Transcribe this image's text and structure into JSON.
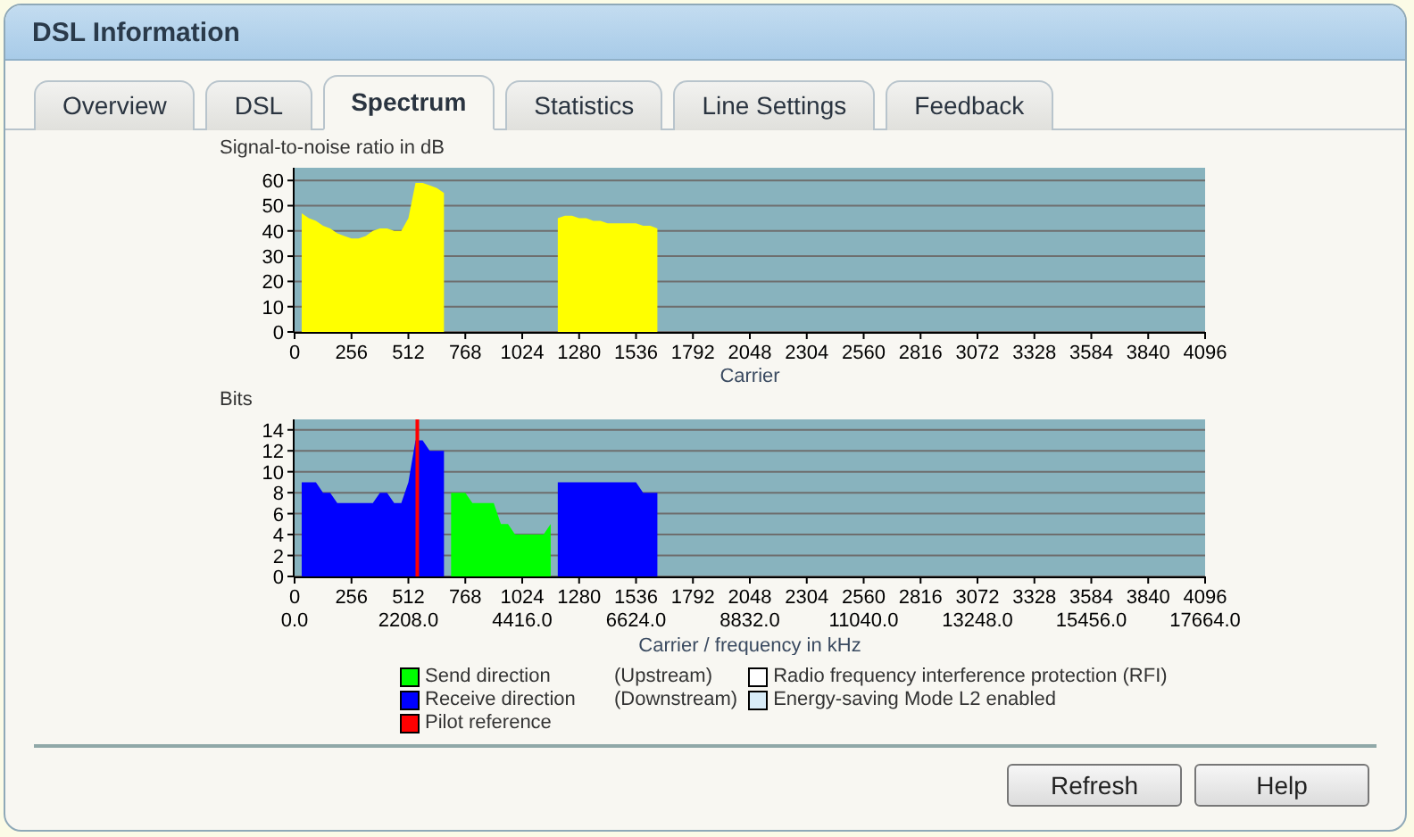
{
  "window": {
    "title": "DSL Information"
  },
  "tabs": [
    {
      "label": "Overview",
      "selected": false
    },
    {
      "label": "DSL",
      "selected": false
    },
    {
      "label": "Spectrum",
      "selected": true
    },
    {
      "label": "Statistics",
      "selected": false
    },
    {
      "label": "Line Settings",
      "selected": false
    },
    {
      "label": "Feedback",
      "selected": false
    }
  ],
  "snr_chart": {
    "chart_data": {
      "type": "area",
      "title": "Signal-to-noise ratio in dB",
      "xlabel": "Carrier",
      "grid": true,
      "x": [
        32,
        64,
        96,
        128,
        160,
        192,
        224,
        256,
        288,
        320,
        352,
        384,
        416,
        448,
        480,
        512,
        544,
        576,
        608,
        640,
        672,
        704,
        736,
        768,
        800,
        832,
        864,
        896,
        928,
        960,
        992,
        1024,
        1056,
        1088,
        1120,
        1152,
        1184,
        1216,
        1248,
        1280,
        1312,
        1344,
        1376,
        1408,
        1440,
        1472,
        1504,
        1536,
        1568,
        1600,
        1632
      ],
      "series": [
        {
          "color": "#ffff00",
          "values": [
            47,
            45,
            44,
            42,
            41,
            39,
            38,
            37,
            37,
            38,
            40,
            41,
            41,
            40,
            40,
            45,
            59,
            59,
            58,
            57,
            55,
            null,
            null,
            null,
            null,
            null,
            null,
            null,
            null,
            null,
            null,
            null,
            null,
            null,
            null,
            null,
            45,
            46,
            46,
            45,
            45,
            44,
            44,
            43,
            43,
            43,
            43,
            43,
            42,
            42,
            41
          ]
        }
      ],
      "xlim": [
        0,
        4096
      ],
      "ylim": [
        0,
        65
      ],
      "xticks": [
        0,
        256,
        512,
        768,
        1024,
        1280,
        1536,
        1792,
        2048,
        2304,
        2560,
        2816,
        3072,
        3328,
        3584,
        3840,
        4096
      ],
      "yticks": [
        0,
        10,
        20,
        30,
        40,
        50,
        60
      ]
    }
  },
  "bits_chart": {
    "chart_data": {
      "type": "area",
      "title": "Bits",
      "xlabel": "Carrier / frequency in kHz",
      "grid": true,
      "x": [
        32,
        64,
        96,
        128,
        160,
        192,
        224,
        256,
        288,
        320,
        352,
        384,
        416,
        448,
        480,
        512,
        544,
        576,
        608,
        640,
        672,
        704,
        736,
        768,
        800,
        832,
        864,
        896,
        928,
        960,
        992,
        1024,
        1056,
        1088,
        1120,
        1152,
        1184,
        1216,
        1248,
        1280,
        1312,
        1344,
        1376,
        1408,
        1440,
        1472,
        1504,
        1536,
        1568,
        1600,
        1632
      ],
      "series": [
        {
          "name": "Send direction",
          "color": "#00ff00",
          "values": [
            null,
            null,
            null,
            null,
            null,
            null,
            null,
            null,
            null,
            null,
            null,
            null,
            null,
            null,
            null,
            null,
            null,
            null,
            null,
            null,
            null,
            8,
            8,
            8,
            7,
            7,
            7,
            7,
            5,
            5,
            4,
            4,
            4,
            4,
            4,
            5,
            null,
            null,
            null,
            null,
            null,
            null,
            null,
            null,
            null,
            null,
            null,
            null,
            null,
            null,
            null
          ]
        },
        {
          "name": "Receive direction",
          "color": "#0000ff",
          "values": [
            9,
            9,
            9,
            8,
            8,
            7,
            7,
            7,
            7,
            7,
            7,
            8,
            8,
            7,
            7,
            9,
            13,
            13,
            12,
            12,
            12,
            null,
            null,
            null,
            null,
            null,
            null,
            null,
            null,
            null,
            null,
            null,
            null,
            null,
            null,
            null,
            9,
            9,
            9,
            9,
            9,
            9,
            9,
            9,
            9,
            9,
            9,
            9,
            8,
            8,
            8
          ]
        }
      ],
      "xlim": [
        0,
        4096
      ],
      "ylim": [
        0,
        15
      ],
      "xticks": [
        0,
        256,
        512,
        768,
        1024,
        1280,
        1536,
        1792,
        2048,
        2304,
        2560,
        2816,
        3072,
        3328,
        3584,
        3840,
        4096
      ],
      "yticks": [
        0,
        2,
        4,
        6,
        8,
        10,
        12,
        14
      ],
      "ref_lines": [
        {
          "axis": "x",
          "value": 552,
          "color": "#ff0000",
          "label": "Pilot reference"
        }
      ]
    },
    "frequency_labels": [
      "0.0",
      "2208.0",
      "4416.0",
      "6624.0",
      "8832.0",
      "11040.0",
      "13248.0",
      "15456.0",
      "17664.0"
    ]
  },
  "legend_notes": [
    "(Upstream)",
    "(Downstream)"
  ],
  "legend_extra": [
    {
      "color": "#ffffff",
      "label": "Radio frequency interference protection (RFI)"
    },
    {
      "color": "#d8ecf8",
      "label": "Energy-saving Mode L2 enabled"
    }
  ],
  "buttons": [
    "Refresh",
    "Help"
  ]
}
